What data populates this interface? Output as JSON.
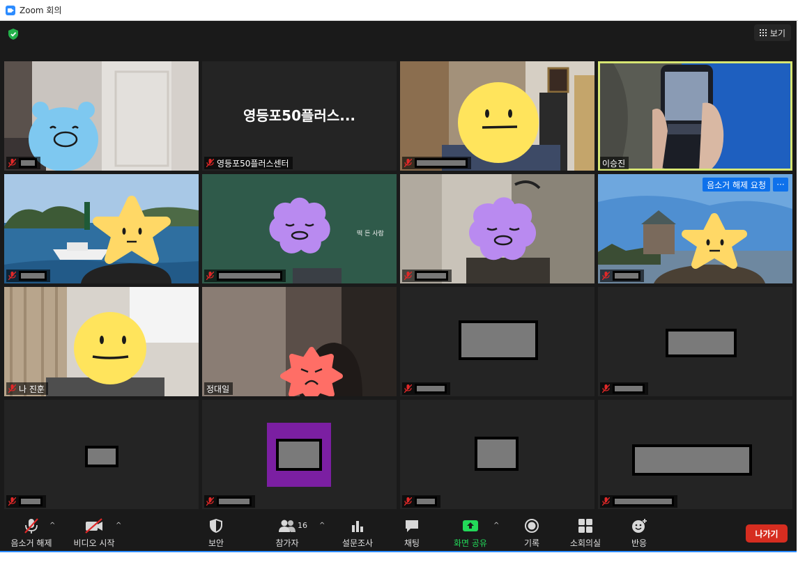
{
  "window": {
    "title": "Zoom 회의"
  },
  "view_button": {
    "label": "보기"
  },
  "tiles": {
    "t1": {
      "name": ""
    },
    "t2": {
      "center_text": "영등포50플러스...",
      "name": "영등포50플러스센터"
    },
    "t4": {
      "name": "이승진"
    },
    "t6_sign": "떡 든 사람",
    "t8": {
      "unmute_request": "음소거 해제 요청",
      "more": "···"
    },
    "t9": {
      "name": "나 진훈"
    },
    "t10": {
      "name": "정대일"
    }
  },
  "toolbar": {
    "mic_label": "음소거 해제",
    "video_label": "비디오 시작",
    "security_label": "보안",
    "participants_label": "참가자",
    "participants_count": "16",
    "polls_label": "설문조사",
    "chat_label": "채팅",
    "share_label": "화면 공유",
    "record_label": "기록",
    "breakout_label": "소회의실",
    "reactions_label": "반응",
    "leave_label": "나가기"
  },
  "colors": {
    "accent": "#2d8cff",
    "share_green": "#23d959",
    "leave_red": "#d62d20",
    "active_speaker": "#d7e672",
    "request_blue": "#0e71eb"
  }
}
